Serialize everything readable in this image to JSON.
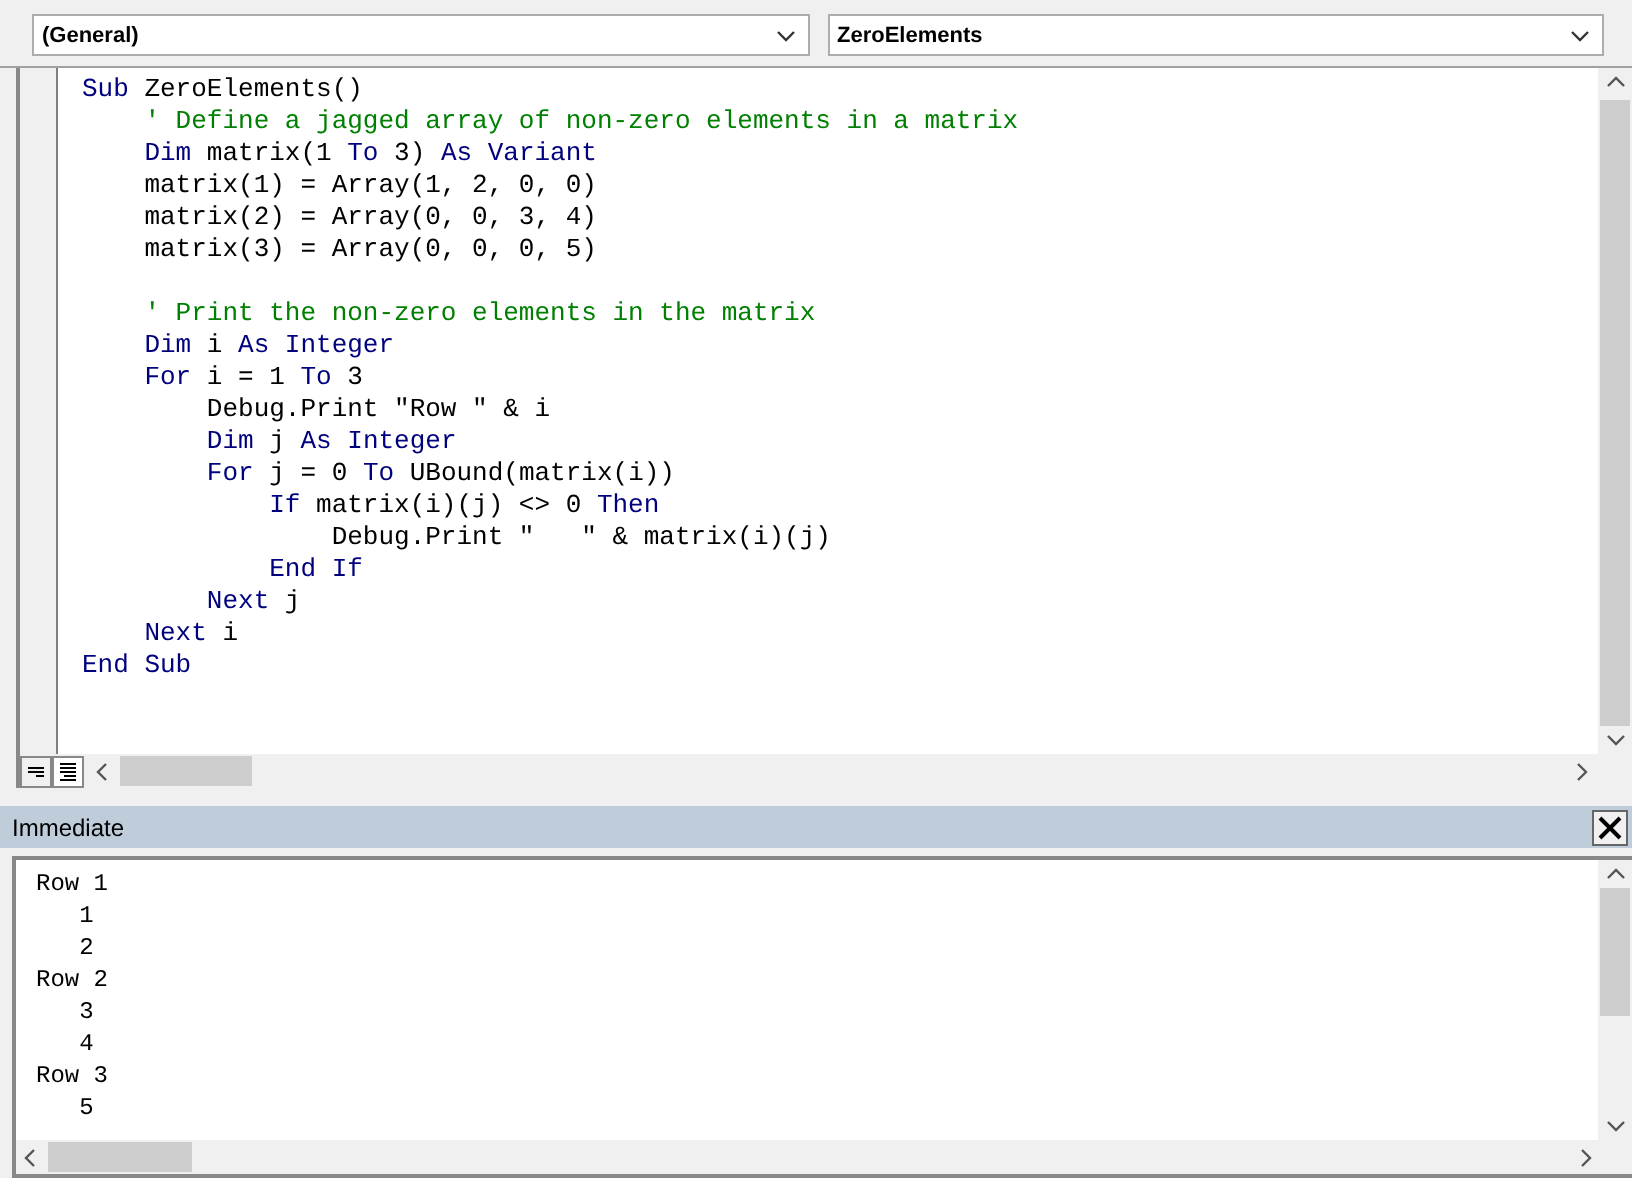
{
  "object_dropdown": {
    "value": "(General)"
  },
  "procedure_dropdown": {
    "value": "ZeroElements"
  },
  "code_lines": [
    {
      "segments": [
        {
          "kind": "keyword",
          "text": "Sub"
        },
        {
          "kind": "plain",
          "text": " ZeroElements()"
        }
      ]
    },
    {
      "segments": [
        {
          "kind": "comment",
          "text": "    ' Define a jagged array of non-zero elements in a matrix"
        }
      ]
    },
    {
      "segments": [
        {
          "kind": "keyword",
          "text": "    Dim"
        },
        {
          "kind": "plain",
          "text": " matrix(1 "
        },
        {
          "kind": "keyword",
          "text": "To"
        },
        {
          "kind": "plain",
          "text": " 3) "
        },
        {
          "kind": "keyword",
          "text": "As Variant"
        }
      ]
    },
    {
      "segments": [
        {
          "kind": "plain",
          "text": "    matrix(1) = Array(1, 2, 0, 0)"
        }
      ]
    },
    {
      "segments": [
        {
          "kind": "plain",
          "text": "    matrix(2) = Array(0, 0, 3, 4)"
        }
      ]
    },
    {
      "segments": [
        {
          "kind": "plain",
          "text": "    matrix(3) = Array(0, 0, 0, 5)"
        }
      ]
    },
    {
      "kind": "blank"
    },
    {
      "segments": [
        {
          "kind": "comment",
          "text": "    ' Print the non-zero elements in the matrix"
        }
      ]
    },
    {
      "segments": [
        {
          "kind": "keyword",
          "text": "    Dim"
        },
        {
          "kind": "plain",
          "text": " i "
        },
        {
          "kind": "keyword",
          "text": "As Integer"
        }
      ]
    },
    {
      "segments": [
        {
          "kind": "keyword",
          "text": "    For"
        },
        {
          "kind": "plain",
          "text": " i = 1 "
        },
        {
          "kind": "keyword",
          "text": "To"
        },
        {
          "kind": "plain",
          "text": " 3"
        }
      ]
    },
    {
      "segments": [
        {
          "kind": "plain",
          "text": "        Debug.Print \"Row \" & i"
        }
      ]
    },
    {
      "segments": [
        {
          "kind": "keyword",
          "text": "        Dim"
        },
        {
          "kind": "plain",
          "text": " j "
        },
        {
          "kind": "keyword",
          "text": "As Integer"
        }
      ]
    },
    {
      "segments": [
        {
          "kind": "keyword",
          "text": "        For"
        },
        {
          "kind": "plain",
          "text": " j = 0 "
        },
        {
          "kind": "keyword",
          "text": "To"
        },
        {
          "kind": "plain",
          "text": " UBound(matrix(i))"
        }
      ]
    },
    {
      "segments": [
        {
          "kind": "keyword",
          "text": "            If"
        },
        {
          "kind": "plain",
          "text": " matrix(i)(j) <> 0 "
        },
        {
          "kind": "keyword",
          "text": "Then"
        }
      ]
    },
    {
      "segments": [
        {
          "kind": "plain",
          "text": "                Debug.Print \"   \" & matrix(i)(j)"
        }
      ]
    },
    {
      "segments": [
        {
          "kind": "keyword",
          "text": "            End If"
        }
      ]
    },
    {
      "segments": [
        {
          "kind": "keyword",
          "text": "        Next"
        },
        {
          "kind": "plain",
          "text": " j"
        }
      ]
    },
    {
      "segments": [
        {
          "kind": "keyword",
          "text": "    Next"
        },
        {
          "kind": "plain",
          "text": " i"
        }
      ]
    },
    {
      "segments": [
        {
          "kind": "keyword",
          "text": "End Sub"
        }
      ]
    }
  ],
  "immediate": {
    "title": "Immediate",
    "lines": [
      "Row 1",
      "   1",
      "   2",
      "Row 2",
      "   3",
      "   4",
      "Row 3",
      "   5"
    ]
  }
}
